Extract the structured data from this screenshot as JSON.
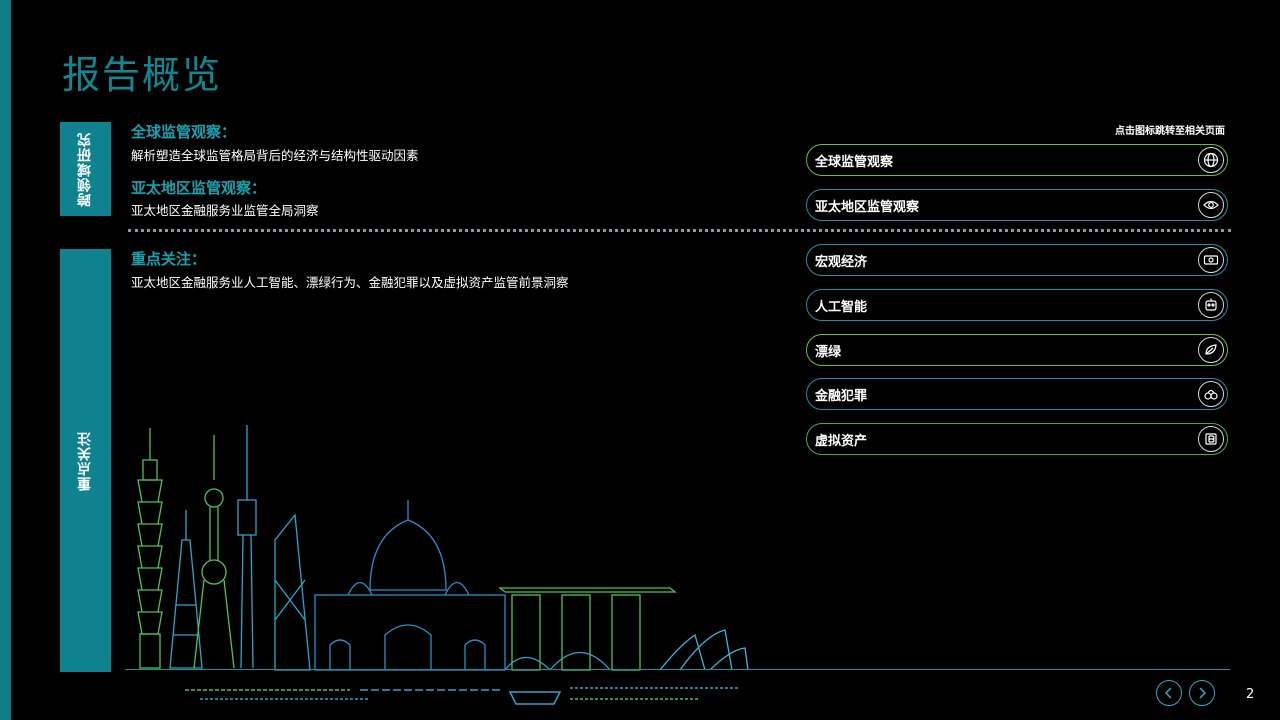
{
  "page": {
    "title": "报告概览",
    "page_number": "2"
  },
  "side_labels": {
    "top": "跨领域研究",
    "bottom": "重点关注"
  },
  "sections": [
    {
      "heading": "全球监管观察：",
      "text": "解析塑造全球监管格局背后的经济与结构性驱动因素"
    },
    {
      "heading": "亚太地区监管观察：",
      "text": "亚太地区金融服务业监管全局洞察"
    },
    {
      "heading": "重点关注：",
      "text": "亚太地区金融服务业人工智能、漂绿行为、金融犯罪以及虚拟资产监管前景洞察"
    }
  ],
  "nav_hint": "点击图标跳转至相关页面",
  "links": [
    {
      "label": "全球监管观察",
      "icon": "globe-icon"
    },
    {
      "label": "亚太地区监管观察",
      "icon": "eye-icon"
    },
    {
      "label": "宏观经济",
      "icon": "money-icon"
    },
    {
      "label": "人工智能",
      "icon": "robot-icon"
    },
    {
      "label": "漂绿",
      "icon": "leaf-hand-icon"
    },
    {
      "label": "金融犯罪",
      "icon": "handcuffs-icon"
    },
    {
      "label": "虚拟资产",
      "icon": "crypto-icon"
    }
  ],
  "colors": {
    "accent_teal": "#0f8290",
    "heading_teal": "#16a3b1",
    "green": "#6cc12a",
    "blue": "#1f8fa8"
  },
  "navigation": {
    "prev": "chevron-left-icon",
    "next": "chevron-right-icon"
  }
}
